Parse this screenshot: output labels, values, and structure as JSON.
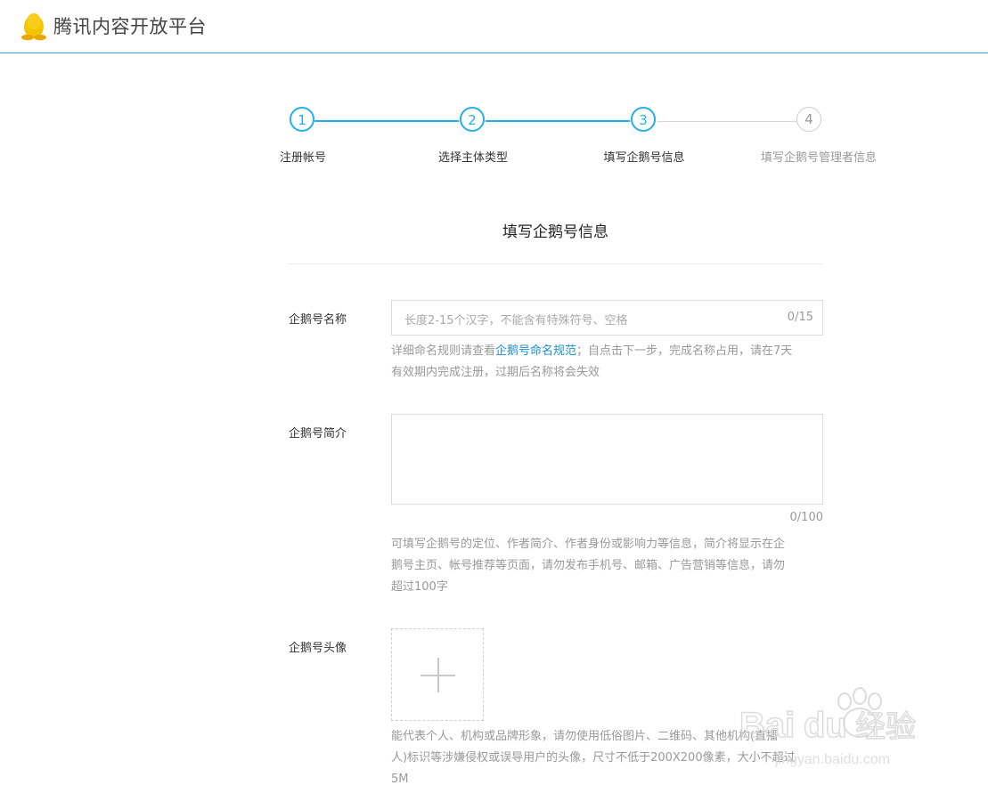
{
  "header": {
    "brand": "腾讯内容开放平台",
    "logo_icon": "penguin-icon"
  },
  "steps": [
    {
      "number": "1",
      "label": "注册帐号",
      "active": true
    },
    {
      "number": "2",
      "label": "选择主体类型",
      "active": true
    },
    {
      "number": "3",
      "label": "填写企鹅号信息",
      "active": true
    },
    {
      "number": "4",
      "label": "填写企鹅号管理者信息",
      "active": false
    }
  ],
  "form": {
    "title": "填写企鹅号信息",
    "name": {
      "label": "企鹅号名称",
      "placeholder": "长度2-15个汉字，不能含有特殊符号、空格",
      "counter": "0/15",
      "hint_prefix": "详细命名规则请查看",
      "hint_link": "企鹅号命名规范",
      "hint_suffix_line1": "；自点击下一步，完成名称占用，请在7天",
      "hint_line2": "有效期内完成注册，过期后名称将会失效"
    },
    "intro": {
      "label": "企鹅号简介",
      "counter": "0/100",
      "hint_line1": "可填写企鹅号的定位、作者简介、作者身份或影响力等信息，简介将显示在企",
      "hint_line2": "鹅号主页、帐号推荐等页面，请勿发布手机号、邮箱、广告营销等信息，请勿",
      "hint_line3": "超过100字"
    },
    "avatar": {
      "label": "企鹅号头像",
      "upload_icon": "plus-icon",
      "hint_line1": "能代表个人、机构或品牌形象，请勿使用低俗图片、二维码、其他机构(直播",
      "hint_line2": "人)标识等涉嫌侵权或误导用户的头像，尺寸不低于200X200像素，大小不超过",
      "hint_line3": "5M"
    }
  },
  "watermark": {
    "text": "Baidu经验",
    "url_text": "jingyan.baidu.com"
  },
  "colors": {
    "accent": "#26b0e8",
    "link": "#1a8fd1",
    "header_border": "#2ea7e0",
    "inactive": "#cfcfcf"
  }
}
